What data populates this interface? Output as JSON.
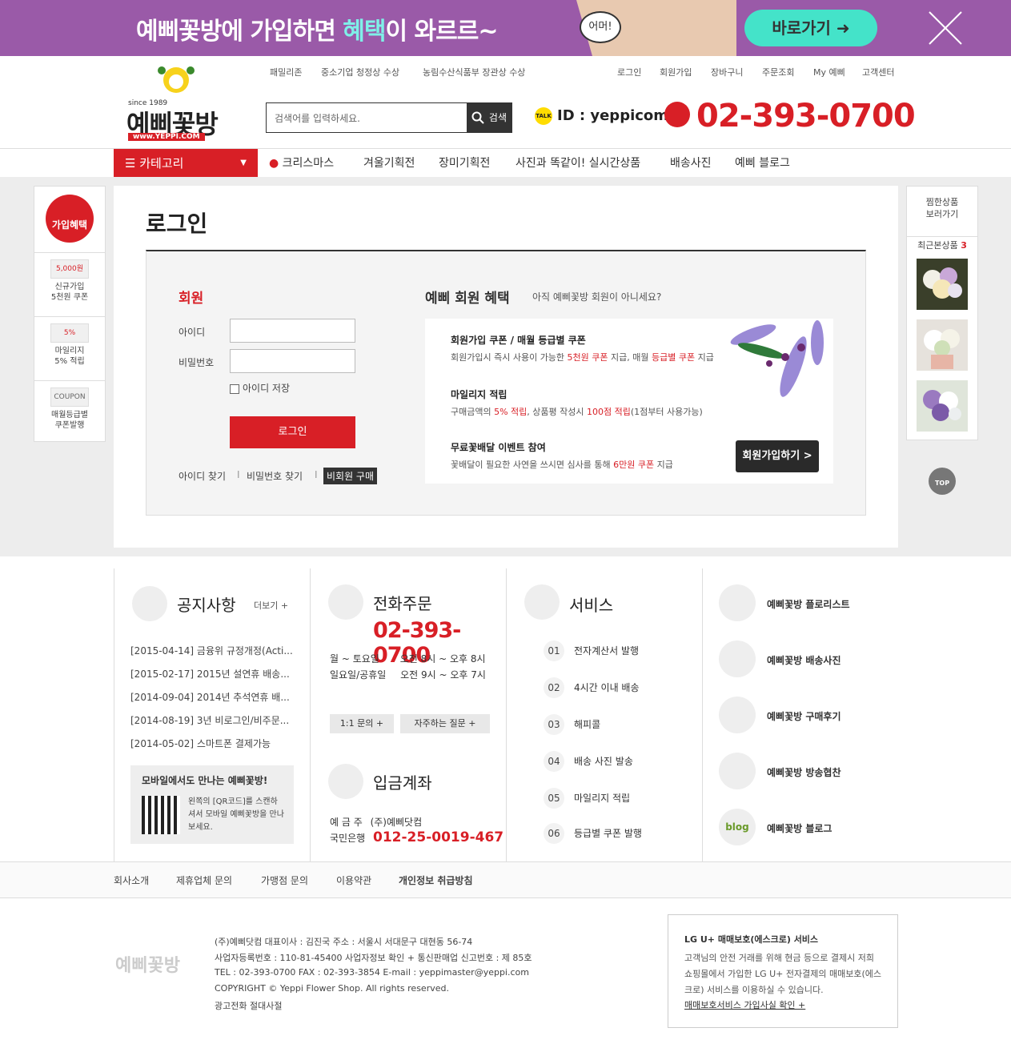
{
  "banner": {
    "text_before": "예삐꽃방에 가입하면 ",
    "text_highlight": "혜택",
    "text_after": "이 와르르~",
    "bubble": "어머!",
    "go_button": "바로가기"
  },
  "header": {
    "left_links": [
      "패밀리존",
      "중소기업 청정상 수상",
      "농림수산식품부 장관상 수상"
    ],
    "right_links": [
      "로그인",
      "회원가입",
      "장바구니",
      "주문조회",
      "My 예삐",
      "고객센터"
    ],
    "logo_since": "since 1989",
    "logo_name": "예삐꽃방",
    "logo_url": "www.YEPPI.COM",
    "search_placeholder": "검색어를 입력하세요.",
    "search_button": "검색",
    "kakao_talk": "TALK",
    "kakao_id": "ID : yeppicom",
    "phone": "02-393-0700"
  },
  "nav": {
    "category": "카테고리",
    "items": [
      "크리스마스",
      "겨울기획전",
      "장미기획전",
      "사진과 똑같이! 실시간상품",
      "배송사진",
      "예삐 블로그"
    ]
  },
  "left_sidebar": {
    "badge": "가입혜택",
    "items": [
      {
        "img": "5,000원",
        "label": "신규가입\n5천원 쿠폰"
      },
      {
        "img": "5%",
        "label": "마일리지\n5% 적립"
      },
      {
        "img": "COUPON",
        "label": "매월등급별\n쿠폰발행"
      }
    ]
  },
  "login": {
    "title": "로그인",
    "member_title": "회원",
    "id_label": "아이디",
    "pw_label": "비밀번호",
    "save_id": "아이디 저장",
    "login_button": "로그인",
    "find_id": "아이디 찾기",
    "find_pw": "비밀번호 찾기",
    "guest": "비회원 구매",
    "benefit_title": "예삐 회원 혜택",
    "benefit_sub": "아직 예삐꽃방 회원이 아니세요?",
    "benefits": [
      {
        "title": "회원가입 쿠폰 / 매월 등급별 쿠폰",
        "d1": "회원가입시 즉시 사용이 가능한 ",
        "r1": "5천원 쿠폰",
        "d2": " 지급, 매월 ",
        "r2": "등급별 쿠폰",
        "d3": " 지급"
      },
      {
        "title": "마일리지 적립",
        "d1": "구매금액의 ",
        "r1": "5% 적립",
        "d2": ", 상품평 작성시 ",
        "r2": "100점 적립",
        "d3": "(1점부터 사용가능)"
      },
      {
        "title": "무료꽃배달 이벤트 참여",
        "d1": "꽃배달이 필요한 사연을 쓰시면 심사를 통해 ",
        "r1": "6만원 쿠폰",
        "d2": " 지급",
        "r2": "",
        "d3": ""
      }
    ],
    "join_button": "회원가입하기 >"
  },
  "right_sidebar": {
    "wish": "찜한상품\n보러가기",
    "recent_label": "최근본상품",
    "recent_count": "3",
    "top": "TOP"
  },
  "footer": {
    "notice_title": "공지사항",
    "notice_more": "더보기 +",
    "notices": [
      "[2015-04-14] 금융위 규정개정(Acti...",
      "[2015-02-17] 2015년 설연휴 배송...",
      "[2014-09-04] 2014년 추석연휴 배...",
      "[2014-08-19] 3년 비로그인/비주문...",
      "[2014-05-02] 스마트폰 결제가능"
    ],
    "mobile_title": "모바일에서도 만나는 예삐꽃방!",
    "mobile_desc": "왼쪽의 [QR코드]를 스캔하셔서 모바일 예삐꽃방을 만나보세요.",
    "phone_title": "전화주문",
    "phone": "02-393-0700",
    "hours": [
      {
        "day": "월 ~ 토요일",
        "time": "오전 8시 ~ 오후 8시"
      },
      {
        "day": "일요일/공휴일",
        "time": "오전 9시 ~ 오후 7시"
      }
    ],
    "qa_button": "1:1 문의 +",
    "faq_button": "자주하는 질문 +",
    "bank_title": "입금계좌",
    "bank_holder_label": "예 금 주",
    "bank_holder": "(주)예삐닷컴",
    "bank_name": "국민은행",
    "bank_account": "012-25-0019-467",
    "service_title": "서비스",
    "services": [
      {
        "n": "01",
        "label": "전자계산서 발행"
      },
      {
        "n": "02",
        "label": "4시간 이내 배송"
      },
      {
        "n": "03",
        "label": "해피콜"
      },
      {
        "n": "04",
        "label": "배송 사진 발송"
      },
      {
        "n": "05",
        "label": "마일리지 적립"
      },
      {
        "n": "06",
        "label": "등급별 쿠폰 발행"
      }
    ],
    "links": [
      "예삐꽃방 플로리스트",
      "예삐꽃방 배송사진",
      "예삐꽃방 구매후기",
      "예삐꽃방 방송협찬",
      "예삐꽃방 블로그"
    ],
    "blog_icon": "blog"
  },
  "footnav": [
    "회사소개",
    "제휴업체 문의",
    "가맹점 문의",
    "이용약관",
    "개인정보 취급방침"
  ],
  "footinfo": {
    "logo": "예삐꽃방",
    "lines": [
      "(주)예삐닷컴     대표이사 : 김진국     주소 : 서울시 서대문구 대현동 56-74",
      "사업자등록번호 : 110-81-45400  사업자정보 확인 +     통신판매업 신고번호 : 제 85호",
      "TEL : 02-393-0700     FAX : 02-393-3854     E-mail : yeppimaster@yeppi.com",
      "COPYRIGHT © Yeppi Flower Shop. All rights reserved.",
      "광고전화 절대사절"
    ],
    "escrow_title": "LG U+ 매매보호(에스크로) 서비스",
    "escrow_desc": "고객님의 안전 거래를 위해 현금 등으로 결제시 저희 쇼핑몰에서 가입한 LG U+ 전자결제의 매매보호(에스크로) 서비스를 이용하실 수 있습니다.",
    "escrow_link": "매매보호서비스 가입사실 확인 +"
  },
  "colors": {
    "brand_red": "#d81f26",
    "banner_purple": "#9a5aa8",
    "banner_button": "#44e3c9"
  }
}
